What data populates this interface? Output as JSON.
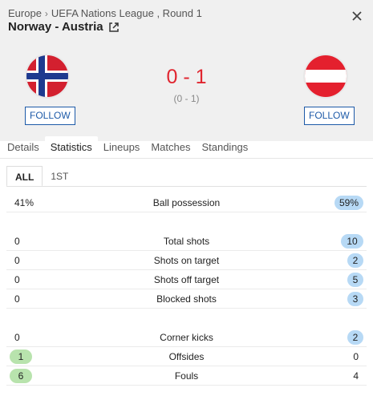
{
  "breadcrumb": {
    "region": "Europe",
    "separator": "›",
    "competition": "UEFA Nations League , Round 1"
  },
  "match": {
    "title": "Norway - Austria",
    "score": "0 - 1",
    "half_time": "(0 - 1)"
  },
  "home": {
    "follow": "FOLLOW",
    "flag_icon": "norway-flag-icon"
  },
  "away": {
    "follow": "FOLLOW",
    "flag_icon": "austria-flag-icon"
  },
  "tabs": [
    "Details",
    "Statistics",
    "Lineups",
    "Matches",
    "Standings"
  ],
  "active_tab": "Statistics",
  "subtabs": [
    "ALL",
    "1ST"
  ],
  "active_subtab": "ALL",
  "stats": {
    "possession": {
      "name": "Ball possession",
      "home": "41%",
      "away": "59%"
    },
    "total_shots": {
      "name": "Total shots",
      "home": "0",
      "away": "10"
    },
    "shots_on": {
      "name": "Shots on target",
      "home": "0",
      "away": "2"
    },
    "shots_off": {
      "name": "Shots off target",
      "home": "0",
      "away": "5"
    },
    "blocked": {
      "name": "Blocked shots",
      "home": "0",
      "away": "3"
    },
    "corners": {
      "name": "Corner kicks",
      "home": "0",
      "away": "2"
    },
    "offsides": {
      "name": "Offsides",
      "home": "1",
      "away": "0"
    },
    "fouls": {
      "name": "Fouls",
      "home": "6",
      "away": "4"
    }
  },
  "colors": {
    "score": "#e0252f",
    "follow": "#1d5aa8",
    "home_highlight": "#b8e3ad",
    "away_highlight": "#b7d9f5"
  }
}
